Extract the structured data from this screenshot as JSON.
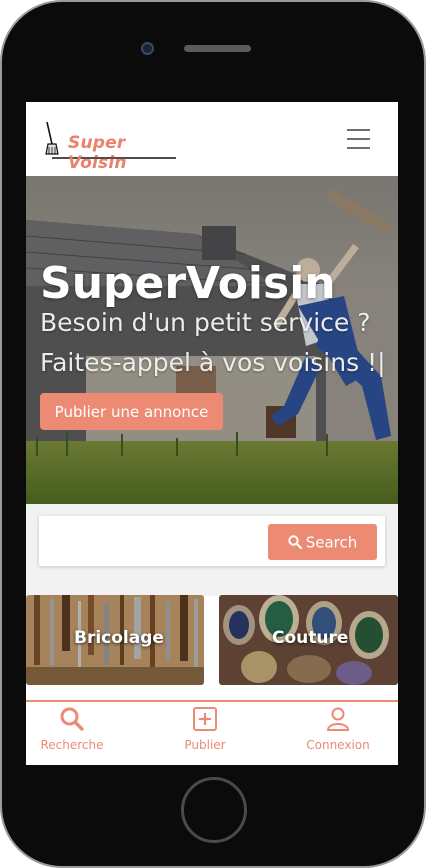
{
  "header": {
    "logo_text": "Super Voisin",
    "menu_icon": "hamburger-menu-icon"
  },
  "hero": {
    "title": "SuperVoisin",
    "line1": "Besoin d'un petit service ?",
    "line2": "Faites-appel à vos voisins !|",
    "cta_label": "Publier une annonce"
  },
  "search": {
    "input_value": "",
    "button_label": "Search",
    "button_icon": "search-icon"
  },
  "categories": [
    {
      "label": "Bricolage"
    },
    {
      "label": "Couture"
    }
  ],
  "bottom_nav": {
    "items": [
      {
        "label": "Recherche",
        "icon": "search-icon"
      },
      {
        "label": "Publier",
        "icon": "plus-square-icon"
      },
      {
        "label": "Connexion",
        "icon": "user-icon"
      }
    ]
  },
  "colors": {
    "accent": "#ed8a73",
    "logo": "#e8826c"
  }
}
